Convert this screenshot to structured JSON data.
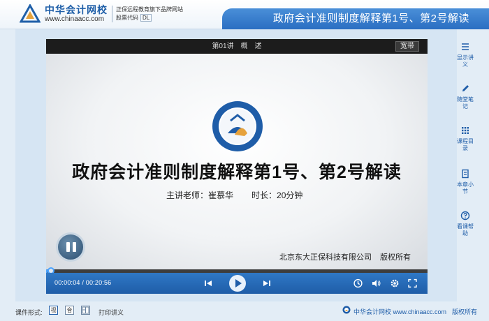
{
  "header": {
    "brand_name": "中华会计网校",
    "brand_url": "www.chinaacc.com",
    "tagline": "正保远程教育旗下品牌网站",
    "stock_label": "股票代码",
    "stock_code": "DL",
    "course_title": "政府会计准则制度解释第1号、第2号解读"
  },
  "player": {
    "lecture_title": "第01讲　概　述",
    "wide_button": "宽带",
    "slide": {
      "title": "政府会计准则制度解释第1号、第2号解读",
      "teacher": "主讲老师：崔慕华",
      "duration": "时长：20分钟",
      "company": "北京东大正保科技有限公司",
      "rights": "版权所有"
    },
    "current_time": "00:00:04",
    "time_separator": "/",
    "total_time": "00:20:56",
    "progress_percent": 0.3,
    "state": "paused"
  },
  "sidebar": {
    "items": [
      {
        "icon": "menu-icon",
        "label": "显示讲义"
      },
      {
        "icon": "pencil-icon",
        "label": "随堂笔记"
      },
      {
        "icon": "grid-icon",
        "label": "课程目录"
      },
      {
        "icon": "book-icon",
        "label": "本章小节"
      },
      {
        "icon": "help-icon",
        "label": "看课帮助"
      }
    ]
  },
  "footer": {
    "mode_label": "课件形式:",
    "mode_options": [
      "视",
      "音",
      ""
    ],
    "print_label": "打印讲义",
    "brand_text": "中华会计网校 www.chinaacc.com",
    "rights_text": "版权所有"
  },
  "colors": {
    "accent": "#1f5da8",
    "banner": "#3a80d0",
    "control_bar": "#2a6dbb",
    "background": "#e3edf6"
  }
}
